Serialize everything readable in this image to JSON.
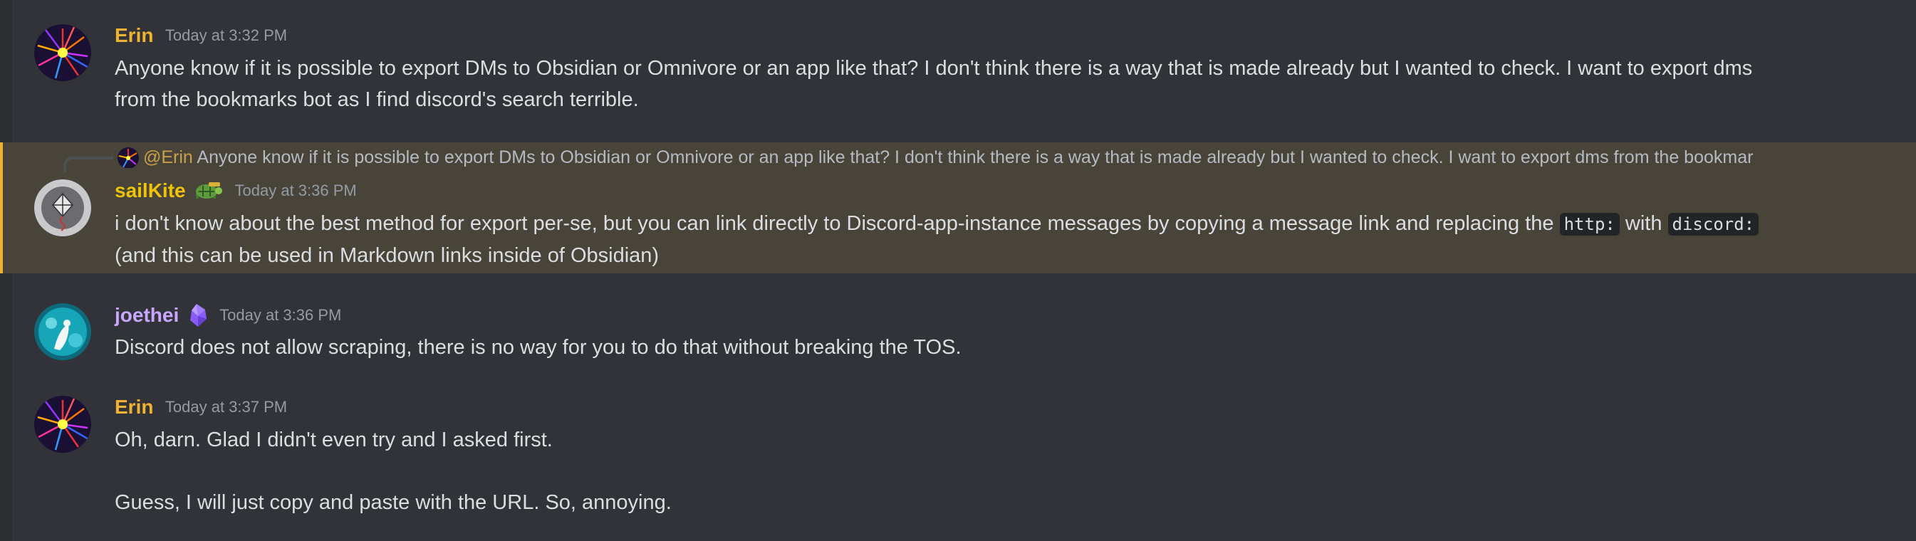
{
  "colors": {
    "background": "#313338",
    "highlight_background": "#48443a",
    "highlight_bar": "#f0b232",
    "erin": "#f0b232",
    "sailkite": "#f0c30a",
    "joethei": "#c9a7ff",
    "timestamp": "#949ba4"
  },
  "messages": [
    {
      "author": "Erin",
      "timestamp": "Today at 3:32 PM",
      "avatar": "erin-fireworks-avatar",
      "lines": [
        "Anyone know if it is possible to export DMs to Obsidian or Omnivore or an app like that? I don't think there is a way that is made already but I wanted to check. I want to export dms",
        "from the bookmarks bot as I find discord's search terrible."
      ]
    },
    {
      "author": "sailKite",
      "timestamp": "Today at 3:36 PM",
      "avatar": "kite-avatar",
      "badge": "turtle-badge-icon",
      "highlighted": true,
      "reply": {
        "mention": "@Erin",
        "preview": "Anyone know if it is possible to export DMs to Obsidian or Omnivore or an app like that? I don't think there is a way that is made already but I wanted to check. I want to export dms from the bookmar"
      },
      "line1_before": "i don't know about the best method for export per-se, but you can link directly to Discord-app-instance messages by copying a message link and replacing the ",
      "code1": "http:",
      "line1_middle": " with ",
      "code2": "discord:",
      "line2": "(and this can be used in Markdown links inside of Obsidian)"
    },
    {
      "author": "joethei",
      "timestamp": "Today at 3:36 PM",
      "avatar": "joethei-avatar",
      "badge": "obsidian-crystal-icon",
      "lines": [
        "Discord does not allow scraping, there is no way for you to do that without breaking the TOS."
      ]
    },
    {
      "author": "Erin",
      "timestamp": "Today at 3:37 PM",
      "avatar": "erin-fireworks-avatar",
      "lines": [
        "Oh, darn. Glad I didn't even try and I asked first.",
        "",
        "Guess, I will just copy and paste with the URL. So, annoying."
      ]
    }
  ]
}
